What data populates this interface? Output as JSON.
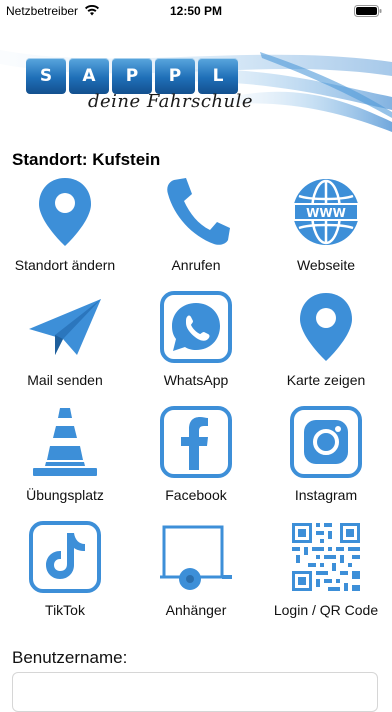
{
  "status_bar": {
    "carrier": "Netzbetreiber",
    "time": "12:50 PM",
    "wifi_icon": "wifi-icon",
    "battery_icon": "battery-icon"
  },
  "header": {
    "logo_letters": [
      "S",
      "A",
      "P",
      "P",
      "L"
    ],
    "tagline": "deine Fahrschule"
  },
  "location": {
    "title": "Standort: Kufstein"
  },
  "tiles": [
    {
      "label": "Standort ändern",
      "icon": "map-pin-icon"
    },
    {
      "label": "Anrufen",
      "icon": "phone-icon"
    },
    {
      "label": "Webseite",
      "icon": "globe-www-icon"
    },
    {
      "label": "Mail senden",
      "icon": "paper-plane-icon"
    },
    {
      "label": "WhatsApp",
      "icon": "whatsapp-icon"
    },
    {
      "label": "Karte zeigen",
      "icon": "map-pin-icon"
    },
    {
      "label": "Übungsplatz",
      "icon": "traffic-cone-icon"
    },
    {
      "label": "Facebook",
      "icon": "facebook-icon"
    },
    {
      "label": "Instagram",
      "icon": "instagram-icon"
    },
    {
      "label": "TikTok",
      "icon": "tiktok-icon"
    },
    {
      "label": "Anhänger",
      "icon": "trailer-icon"
    },
    {
      "label": "Login / QR Code",
      "icon": "qr-code-icon"
    }
  ],
  "login": {
    "username_label": "Benutzername:"
  },
  "colors": {
    "accent": "#3d8fd8",
    "logo_blue": "#1f6fb8",
    "text": "#111111"
  }
}
